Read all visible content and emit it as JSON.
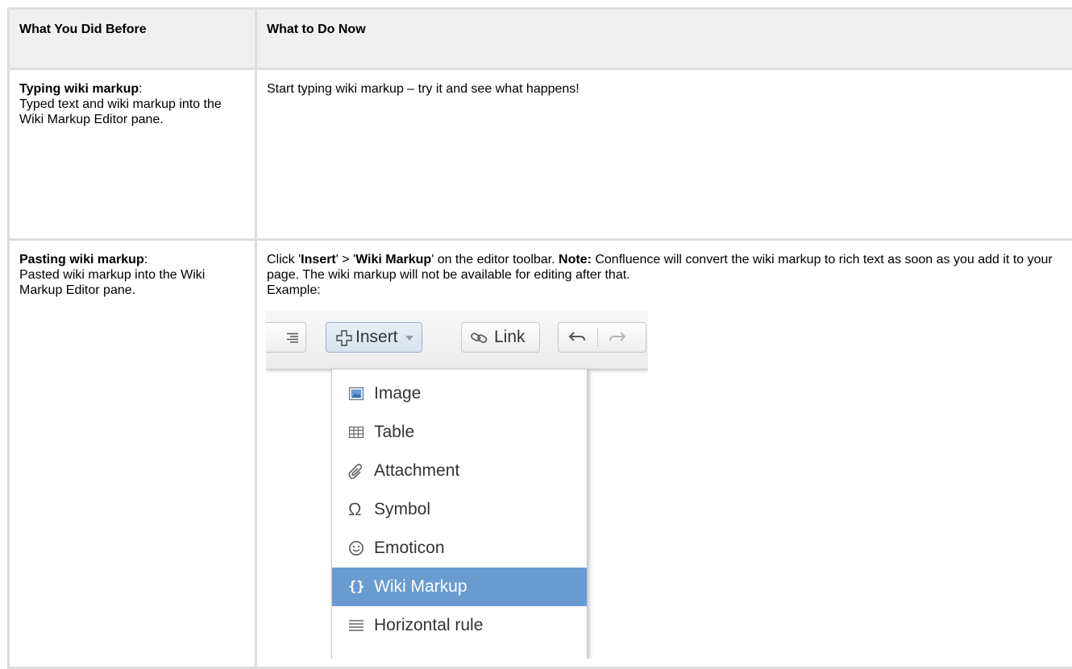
{
  "table": {
    "header": {
      "col1": "What You Did Before",
      "col2": "What to Do Now"
    },
    "rows": [
      {
        "before_bold": "Typing wiki markup",
        "before_colon": ":",
        "before_text": "Typed text and wiki markup into the Wiki Markup Editor pane.",
        "now_text": "Start typing wiki markup – try it and see what happens!"
      },
      {
        "before_bold": "Pasting wiki markup",
        "before_colon": ":",
        "before_text": "Pasted wiki markup into the Wiki Markup Editor pane.",
        "now_click": "Click '",
        "now_insert": "Insert",
        "now_arrow": "' > '",
        "now_wiki": "Wiki Markup",
        "now_toolbar": "' on the editor toolbar. ",
        "now_note_label": "Note:",
        "now_note_text": " Confluence will convert the wiki markup to rich text as soon as you add it to your page. The wiki markup will not be available for editing after that.",
        "now_example": "Example:"
      }
    ]
  },
  "screenshot": {
    "toolbar": {
      "insert_label": "Insert",
      "link_label": "Link"
    },
    "menu_items": [
      {
        "label": "Image",
        "icon": "image-icon"
      },
      {
        "label": "Table",
        "icon": "table-icon"
      },
      {
        "label": "Attachment",
        "icon": "paperclip-icon"
      },
      {
        "label": "Symbol",
        "icon": "omega-icon"
      },
      {
        "label": "Emoticon",
        "icon": "smiley-icon"
      },
      {
        "label": "Wiki Markup",
        "icon": "braces-icon",
        "active": true
      },
      {
        "label": "Horizontal rule",
        "icon": "horizontal-rule-icon"
      }
    ],
    "colors": {
      "menu_highlight": "#6a9bd0",
      "header_bg": "#f0f0f0",
      "border": "#dddddd"
    }
  }
}
